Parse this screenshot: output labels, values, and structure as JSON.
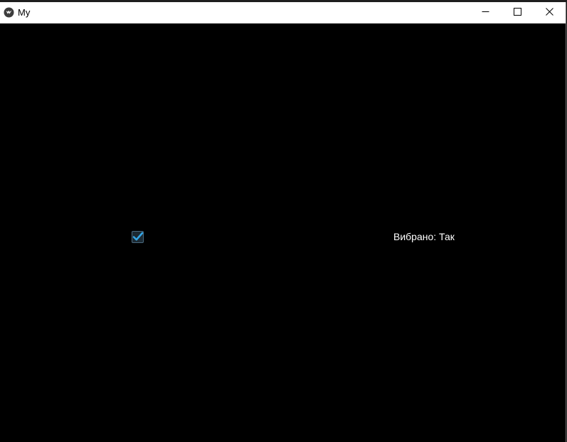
{
  "window": {
    "title": "My",
    "app_icon": "kivy-logo-icon",
    "controls": {
      "minimize_icon": "minimize-icon",
      "maximize_icon": "maximize-icon",
      "close_icon": "close-icon"
    }
  },
  "main": {
    "checkbox": {
      "checked": true,
      "accent_color": "#33a5e5"
    },
    "status_label": "Вибрано: Так"
  }
}
